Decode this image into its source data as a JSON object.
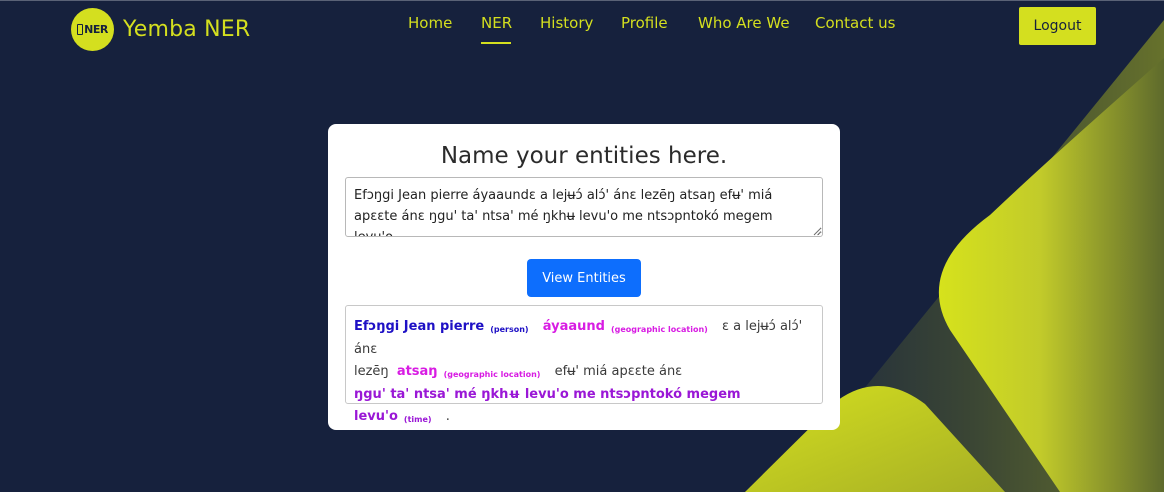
{
  "brand": {
    "logo_text": "NER",
    "name": "Yemba NER"
  },
  "nav": {
    "items": [
      {
        "label": "Home",
        "active": false
      },
      {
        "label": "NER",
        "active": true
      },
      {
        "label": "History",
        "active": false
      },
      {
        "label": "Profile",
        "active": false
      },
      {
        "label": "Who Are We",
        "active": false
      },
      {
        "label": "Contact us",
        "active": false
      }
    ],
    "logout_label": "Logout"
  },
  "card": {
    "title": "Name your entities here.",
    "input_value": "Efɔŋgi Jean pierre áyaaundɛ a lejʉɔ́ alɔ́' ánɛ lezēŋ atsaŋ efʉ' miá apɛɛte ánɛ ŋgu' ta' ntsa' mé ŋkhʉ levu'o me ntsɔpntokó megem levu'o .",
    "button_label": "View Entities",
    "result": {
      "line1": [
        {
          "text": "Efɔŋgi Jean pierre",
          "label": "(person)",
          "type": "person"
        },
        {
          "text": "áyaaund",
          "label": "(geographic location)",
          "type": "geo"
        },
        {
          "text": "ɛ a lejʉɔ́ alɔ́' ánɛ",
          "type": "plain"
        }
      ],
      "line2": [
        {
          "text": "lezēŋ",
          "type": "plain"
        },
        {
          "text": "atsaŋ",
          "label": "(geographic location)",
          "type": "geo"
        },
        {
          "text": "efʉ' miá apɛɛte ánɛ",
          "type": "plain"
        }
      ],
      "line3": [
        {
          "text": "ŋgu' ta' ntsa' mé ŋkhʉ levu'o me ntsɔpntokó megem levu'o",
          "label": "(time)",
          "type": "time"
        },
        {
          "text": ".",
          "type": "plain"
        }
      ]
    }
  },
  "colors": {
    "background": "#16213d",
    "accent": "#d4df1f",
    "primary_button": "#0d6efd",
    "person": "#1e10c5",
    "geographic_location": "#d81ce3",
    "time": "#9a17d6"
  }
}
